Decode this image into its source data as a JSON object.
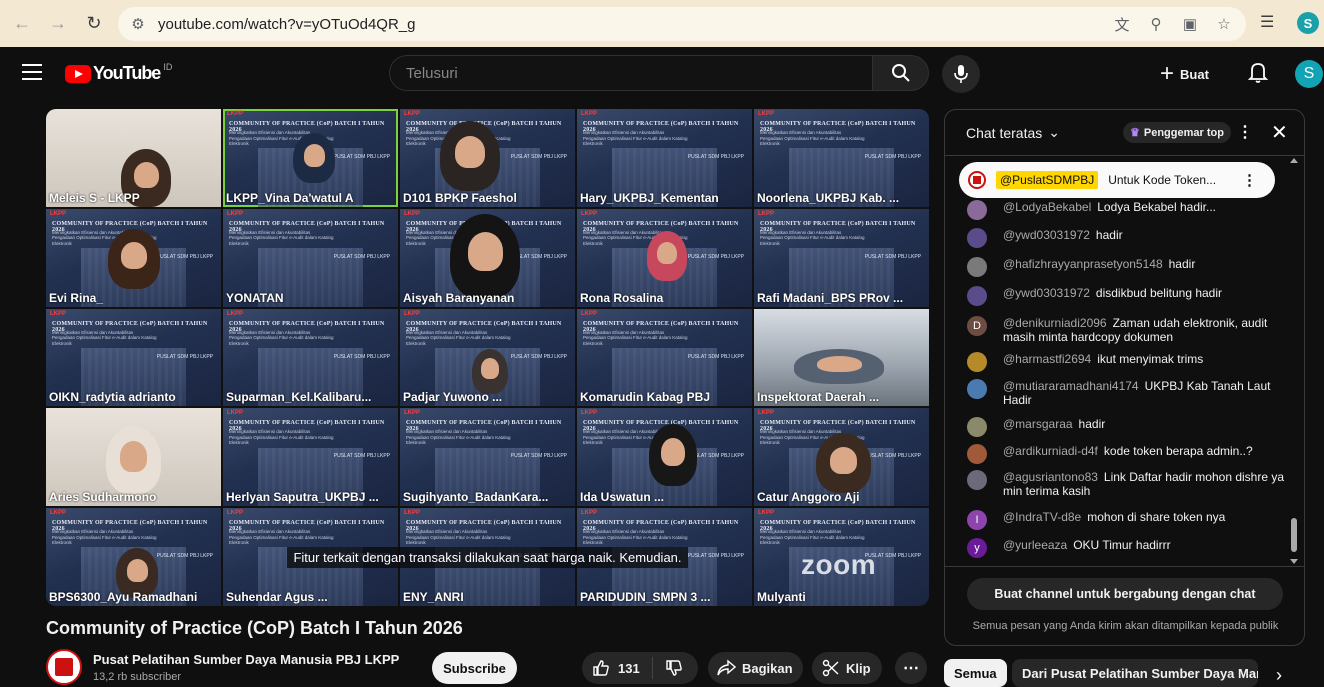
{
  "browser": {
    "url": "youtube.com/watch?v=yOTuOd4QR_g",
    "profile_initial": "S"
  },
  "header": {
    "logo_text": "YouTube",
    "country_code": "ID",
    "search_placeholder": "Telusuri",
    "create_label": "Buat",
    "avatar_initial": "S"
  },
  "player": {
    "caption": "Fitur terkait dengan transaksi dilakukan saat harga naik. Kemudian.",
    "zoom_watermark": "zoom",
    "slide": {
      "org": "LKPP",
      "title": "COMMUNITY OF PRACTICE (CoP) BATCH I TAHUN 2026",
      "subtitle": "Meningkatkan Efisiensi dan Akuntabilitas Pengadaan Optimalisasi Fitur e-Audit dalam Katalog Elektronik",
      "pusat": "PUSLAT SDM PBJ LKPP"
    },
    "participants": [
      "Meleis S - LKPP",
      "LKPP_Vina Da'watul A",
      "D101 BPKP Faeshol",
      "Hary_UKPBJ_Kementan",
      "Noorlena_UKPBJ Kab. ...",
      "Evi Rina_",
      "YONATAN",
      "Aisyah Baranyanan",
      "Rona Rosalina",
      "Rafi Madani_BPS PRov ...",
      "OIKN_radytia adrianto",
      "Suparman_Kel.Kalibaru...",
      "Padjar Yuwono ...",
      "Komarudin Kabag PBJ",
      "Inspektorat Daerah ...",
      "Aries Sudharmono",
      "Herlyan Saputra_UKPBJ ...",
      "Sugihyanto_BadanKara...",
      "Ida Uswatun ...",
      "Catur Anggoro Aji",
      "BPS6300_Ayu Ramadhani",
      "Suhendar Agus ...",
      "ENY_ANRI",
      "PARIDUDIN_SMPN 3 ...",
      "Mulyanti"
    ]
  },
  "video": {
    "title": "Community of Practice (CoP) Batch I Tahun 2026",
    "channel": "Pusat Pelatihan Sumber Daya Manusia PBJ LKPP",
    "subscribers": "13,2 rb subscriber",
    "subscribe_label": "Subscribe",
    "likes": "131",
    "share_label": "Bagikan",
    "clip_label": "Klip"
  },
  "chat": {
    "mode_label": "Chat teratas",
    "fans_label": "Penggemar top",
    "pinned": {
      "author": "@PuslatSDMPBJ",
      "text": "Untuk Kode Token..."
    },
    "messages": [
      {
        "author": "@LodyaBekabel",
        "text": "Lodya Bekabel hadir...",
        "avatar_color": "#8a6a9a",
        "initial": ""
      },
      {
        "author": "@ywd03031972",
        "text": "hadir",
        "avatar_color": "#5a4b8a",
        "initial": ""
      },
      {
        "author": "@hafizhrayyanprasetyon5148",
        "text": "hadir",
        "avatar_color": "#7a7a7a",
        "initial": ""
      },
      {
        "author": "@ywd03031972",
        "text": "disdikbud belitung hadir",
        "avatar_color": "#5a4b8a",
        "initial": ""
      },
      {
        "author": "@denikurniadi2096",
        "text": "Zaman udah elektronik, audit masih minta hardcopy dokumen",
        "avatar_color": "#6d4c41",
        "initial": "D"
      },
      {
        "author": "@harmastfi2694",
        "text": "ikut menyimak trims",
        "avatar_color": "#b58b2a",
        "initial": ""
      },
      {
        "author": "@mutiararamadhani4174",
        "text": "UKPBJ Kab Tanah Laut Hadir",
        "avatar_color": "#4a7ab0",
        "initial": ""
      },
      {
        "author": "@marsgaraa",
        "text": "hadir",
        "avatar_color": "#8a8a6a",
        "initial": ""
      },
      {
        "author": "@ardikurniadi-d4f",
        "text": "kode token berapa admin..?",
        "avatar_color": "#a05a3a",
        "initial": ""
      },
      {
        "author": "@agusriantono83",
        "text": "Link Daftar hadir mohon dishre ya min terima kasih",
        "avatar_color": "#6a6a7a",
        "initial": ""
      },
      {
        "author": "@IndraTV-d8e",
        "text": "mohon di share token nya",
        "avatar_color": "#8e44ad",
        "initial": "I"
      },
      {
        "author": "@yurleeaza",
        "text": "OKU Timur hadirrr",
        "avatar_color": "#6a1b9a",
        "initial": "y"
      }
    ],
    "join_label": "Buat channel untuk bergabung dengan chat",
    "footer_note": "Semua pesan yang Anda kirim akan ditampilkan kepada publik"
  },
  "chips": {
    "all": "Semua",
    "from_channel": "Dari Pusat Pelatihan Sumber Daya Manusia PBJ LKPP"
  }
}
